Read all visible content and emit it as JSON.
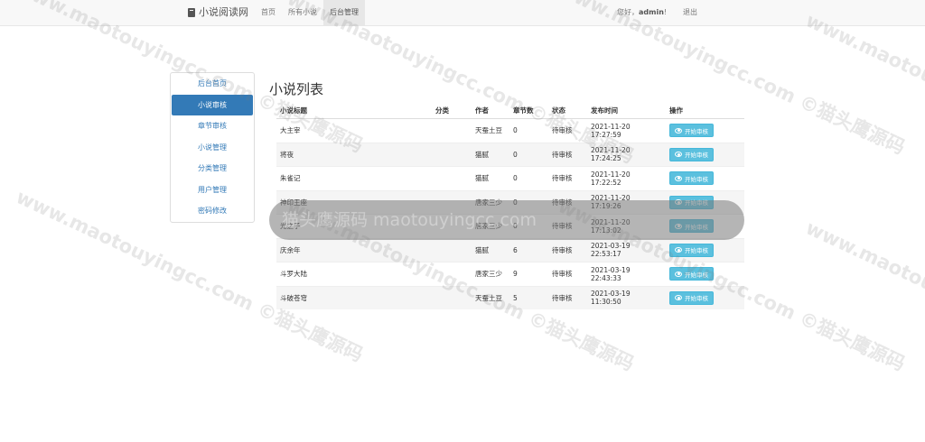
{
  "navbar": {
    "brand": "小说阅读网",
    "links": [
      "首页",
      "所有小说",
      "后台管理"
    ],
    "greeting_prefix": "您好，",
    "username": "admin",
    "greeting_suffix": "!",
    "logout": "退出"
  },
  "sidebar": {
    "items": [
      "后台首页",
      "小说审核",
      "章节审核",
      "小说管理",
      "分类管理",
      "用户管理",
      "密码修改"
    ]
  },
  "main": {
    "title": "小说列表",
    "columns": [
      "小说标题",
      "分类",
      "作者",
      "章节数",
      "状态",
      "发布时间",
      "操作"
    ],
    "rows": [
      {
        "title": "大主宰",
        "category": "",
        "author": "天蚕土豆",
        "chapters": "0",
        "status": "待审核",
        "time": "2021-11-20 17:27:59",
        "action": "开始审核"
      },
      {
        "title": "将夜",
        "category": "",
        "author": "猫腻",
        "chapters": "0",
        "status": "待审核",
        "time": "2021-11-20 17:24:25",
        "action": "开始审核"
      },
      {
        "title": "朱雀记",
        "category": "",
        "author": "猫腻",
        "chapters": "0",
        "status": "待审核",
        "time": "2021-11-20 17:22:52",
        "action": "开始审核"
      },
      {
        "title": "神印王座",
        "category": "",
        "author": "唐家三少",
        "chapters": "0",
        "status": "待审核",
        "time": "2021-11-20 17:19:26",
        "action": "开始审核"
      },
      {
        "title": "光之子",
        "category": "",
        "author": "唐家三少",
        "chapters": "0",
        "status": "待审核",
        "time": "2021-11-20 17:13:02",
        "action": "开始审核"
      },
      {
        "title": "庆余年",
        "category": "",
        "author": "猫腻",
        "chapters": "6",
        "status": "待审核",
        "time": "2021-03-19 22:53:17",
        "action": "开始审核"
      },
      {
        "title": "斗罗大陆",
        "category": "",
        "author": "唐家三少",
        "chapters": "9",
        "status": "待审核",
        "time": "2021-03-19 22:43:33",
        "action": "开始审核"
      },
      {
        "title": "斗破苍穹",
        "category": "",
        "author": "天蚕土豆",
        "chapters": "5",
        "status": "待审核",
        "time": "2021-03-19 11:30:50",
        "action": "开始审核"
      }
    ]
  },
  "watermark": {
    "text_cn": "©猫头鹰源码",
    "text_en": "www.maotouyingcc.com",
    "overlay": "猫头鹰源码 maotouyingcc.com"
  }
}
